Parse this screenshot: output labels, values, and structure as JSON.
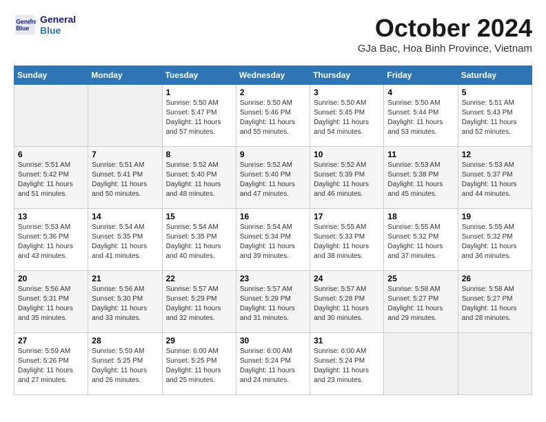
{
  "header": {
    "logo_line1": "General",
    "logo_line2": "Blue",
    "title": "October 2024",
    "subtitle": "GJa Bac, Hoa Binh Province, Vietnam"
  },
  "weekdays": [
    "Sunday",
    "Monday",
    "Tuesday",
    "Wednesday",
    "Thursday",
    "Friday",
    "Saturday"
  ],
  "weeks": [
    [
      {
        "day": "",
        "info": ""
      },
      {
        "day": "",
        "info": ""
      },
      {
        "day": "1",
        "info": "Sunrise: 5:50 AM\nSunset: 5:47 PM\nDaylight: 11 hours and 57 minutes."
      },
      {
        "day": "2",
        "info": "Sunrise: 5:50 AM\nSunset: 5:46 PM\nDaylight: 11 hours and 55 minutes."
      },
      {
        "day": "3",
        "info": "Sunrise: 5:50 AM\nSunset: 5:45 PM\nDaylight: 11 hours and 54 minutes."
      },
      {
        "day": "4",
        "info": "Sunrise: 5:50 AM\nSunset: 5:44 PM\nDaylight: 11 hours and 53 minutes."
      },
      {
        "day": "5",
        "info": "Sunrise: 5:51 AM\nSunset: 5:43 PM\nDaylight: 11 hours and 52 minutes."
      }
    ],
    [
      {
        "day": "6",
        "info": "Sunrise: 5:51 AM\nSunset: 5:42 PM\nDaylight: 11 hours and 51 minutes."
      },
      {
        "day": "7",
        "info": "Sunrise: 5:51 AM\nSunset: 5:41 PM\nDaylight: 11 hours and 50 minutes."
      },
      {
        "day": "8",
        "info": "Sunrise: 5:52 AM\nSunset: 5:40 PM\nDaylight: 11 hours and 48 minutes."
      },
      {
        "day": "9",
        "info": "Sunrise: 5:52 AM\nSunset: 5:40 PM\nDaylight: 11 hours and 47 minutes."
      },
      {
        "day": "10",
        "info": "Sunrise: 5:52 AM\nSunset: 5:39 PM\nDaylight: 11 hours and 46 minutes."
      },
      {
        "day": "11",
        "info": "Sunrise: 5:53 AM\nSunset: 5:38 PM\nDaylight: 11 hours and 45 minutes."
      },
      {
        "day": "12",
        "info": "Sunrise: 5:53 AM\nSunset: 5:37 PM\nDaylight: 11 hours and 44 minutes."
      }
    ],
    [
      {
        "day": "13",
        "info": "Sunrise: 5:53 AM\nSunset: 5:36 PM\nDaylight: 11 hours and 43 minutes."
      },
      {
        "day": "14",
        "info": "Sunrise: 5:54 AM\nSunset: 5:35 PM\nDaylight: 11 hours and 41 minutes."
      },
      {
        "day": "15",
        "info": "Sunrise: 5:54 AM\nSunset: 5:35 PM\nDaylight: 11 hours and 40 minutes."
      },
      {
        "day": "16",
        "info": "Sunrise: 5:54 AM\nSunset: 5:34 PM\nDaylight: 11 hours and 39 minutes."
      },
      {
        "day": "17",
        "info": "Sunrise: 5:55 AM\nSunset: 5:33 PM\nDaylight: 11 hours and 38 minutes."
      },
      {
        "day": "18",
        "info": "Sunrise: 5:55 AM\nSunset: 5:32 PM\nDaylight: 11 hours and 37 minutes."
      },
      {
        "day": "19",
        "info": "Sunrise: 5:55 AM\nSunset: 5:32 PM\nDaylight: 11 hours and 36 minutes."
      }
    ],
    [
      {
        "day": "20",
        "info": "Sunrise: 5:56 AM\nSunset: 5:31 PM\nDaylight: 11 hours and 35 minutes."
      },
      {
        "day": "21",
        "info": "Sunrise: 5:56 AM\nSunset: 5:30 PM\nDaylight: 11 hours and 33 minutes."
      },
      {
        "day": "22",
        "info": "Sunrise: 5:57 AM\nSunset: 5:29 PM\nDaylight: 11 hours and 32 minutes."
      },
      {
        "day": "23",
        "info": "Sunrise: 5:57 AM\nSunset: 5:29 PM\nDaylight: 11 hours and 31 minutes."
      },
      {
        "day": "24",
        "info": "Sunrise: 5:57 AM\nSunset: 5:28 PM\nDaylight: 11 hours and 30 minutes."
      },
      {
        "day": "25",
        "info": "Sunrise: 5:58 AM\nSunset: 5:27 PM\nDaylight: 11 hours and 29 minutes."
      },
      {
        "day": "26",
        "info": "Sunrise: 5:58 AM\nSunset: 5:27 PM\nDaylight: 11 hours and 28 minutes."
      }
    ],
    [
      {
        "day": "27",
        "info": "Sunrise: 5:59 AM\nSunset: 5:26 PM\nDaylight: 11 hours and 27 minutes."
      },
      {
        "day": "28",
        "info": "Sunrise: 5:59 AM\nSunset: 5:25 PM\nDaylight: 11 hours and 26 minutes."
      },
      {
        "day": "29",
        "info": "Sunrise: 6:00 AM\nSunset: 5:25 PM\nDaylight: 11 hours and 25 minutes."
      },
      {
        "day": "30",
        "info": "Sunrise: 6:00 AM\nSunset: 5:24 PM\nDaylight: 11 hours and 24 minutes."
      },
      {
        "day": "31",
        "info": "Sunrise: 6:00 AM\nSunset: 5:24 PM\nDaylight: 11 hours and 23 minutes."
      },
      {
        "day": "",
        "info": ""
      },
      {
        "day": "",
        "info": ""
      }
    ]
  ]
}
